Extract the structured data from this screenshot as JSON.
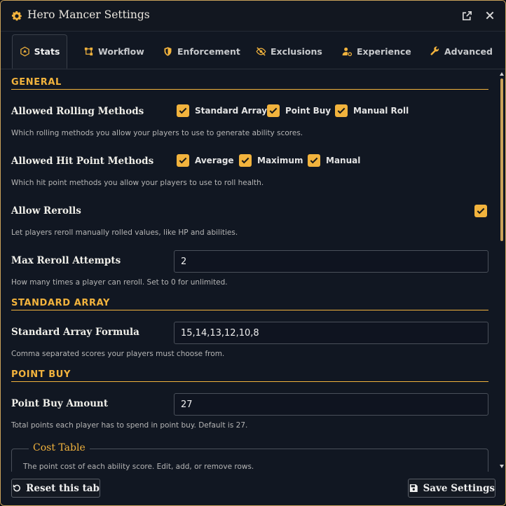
{
  "window": {
    "title": "Hero Mancer Settings"
  },
  "tabs": [
    {
      "label": "Stats",
      "icon": "dice-icon",
      "active": true
    },
    {
      "label": "Workflow",
      "icon": "workflow-icon"
    },
    {
      "label": "Enforcement",
      "icon": "shield-icon"
    },
    {
      "label": "Exclusions",
      "icon": "eye-slash-icon"
    },
    {
      "label": "Experience",
      "icon": "user-gear-icon"
    },
    {
      "label": "Advanced",
      "icon": "wrench-icon"
    }
  ],
  "sections": {
    "general": "GENERAL",
    "standard_array": "STANDARD ARRAY",
    "point_buy": "POINT BUY"
  },
  "rolling": {
    "label": "Allowed Rolling Methods",
    "options": [
      {
        "label": "Standard Array",
        "checked": true
      },
      {
        "label": "Point Buy",
        "checked": true
      },
      {
        "label": "Manual Roll",
        "checked": true
      }
    ],
    "hint": "Which rolling methods you allow your players to use to generate ability scores."
  },
  "hitpoints": {
    "label": "Allowed Hit Point Methods",
    "options": [
      {
        "label": "Average",
        "checked": true
      },
      {
        "label": "Maximum",
        "checked": true
      },
      {
        "label": "Manual",
        "checked": true
      }
    ],
    "hint": "Which hit point methods you allow your players to use to roll health."
  },
  "rerolls": {
    "label": "Allow Rerolls",
    "checked": true,
    "hint": "Let players reroll manually rolled values, like HP and abilities."
  },
  "max_reroll": {
    "label": "Max Reroll Attempts",
    "value": "2",
    "hint": "How many times a player can reroll. Set to 0 for unlimited."
  },
  "array_formula": {
    "label": "Standard Array Formula",
    "value": "15,14,13,12,10,8",
    "hint": "Comma separated scores your players must choose from."
  },
  "point_buy_amount": {
    "label": "Point Buy Amount",
    "value": "27",
    "hint": "Total points each player has to spend in point buy. Default is 27."
  },
  "cost_table": {
    "legend": "Cost Table",
    "hint": "The point cost of each ability score. Edit, add, or remove rows."
  },
  "footer": {
    "reset_label": "Reset this tab",
    "save_label": "Save Settings"
  },
  "colors": {
    "accent": "#f2b33d",
    "border_gold": "#c9a25a",
    "background": "#111722"
  }
}
